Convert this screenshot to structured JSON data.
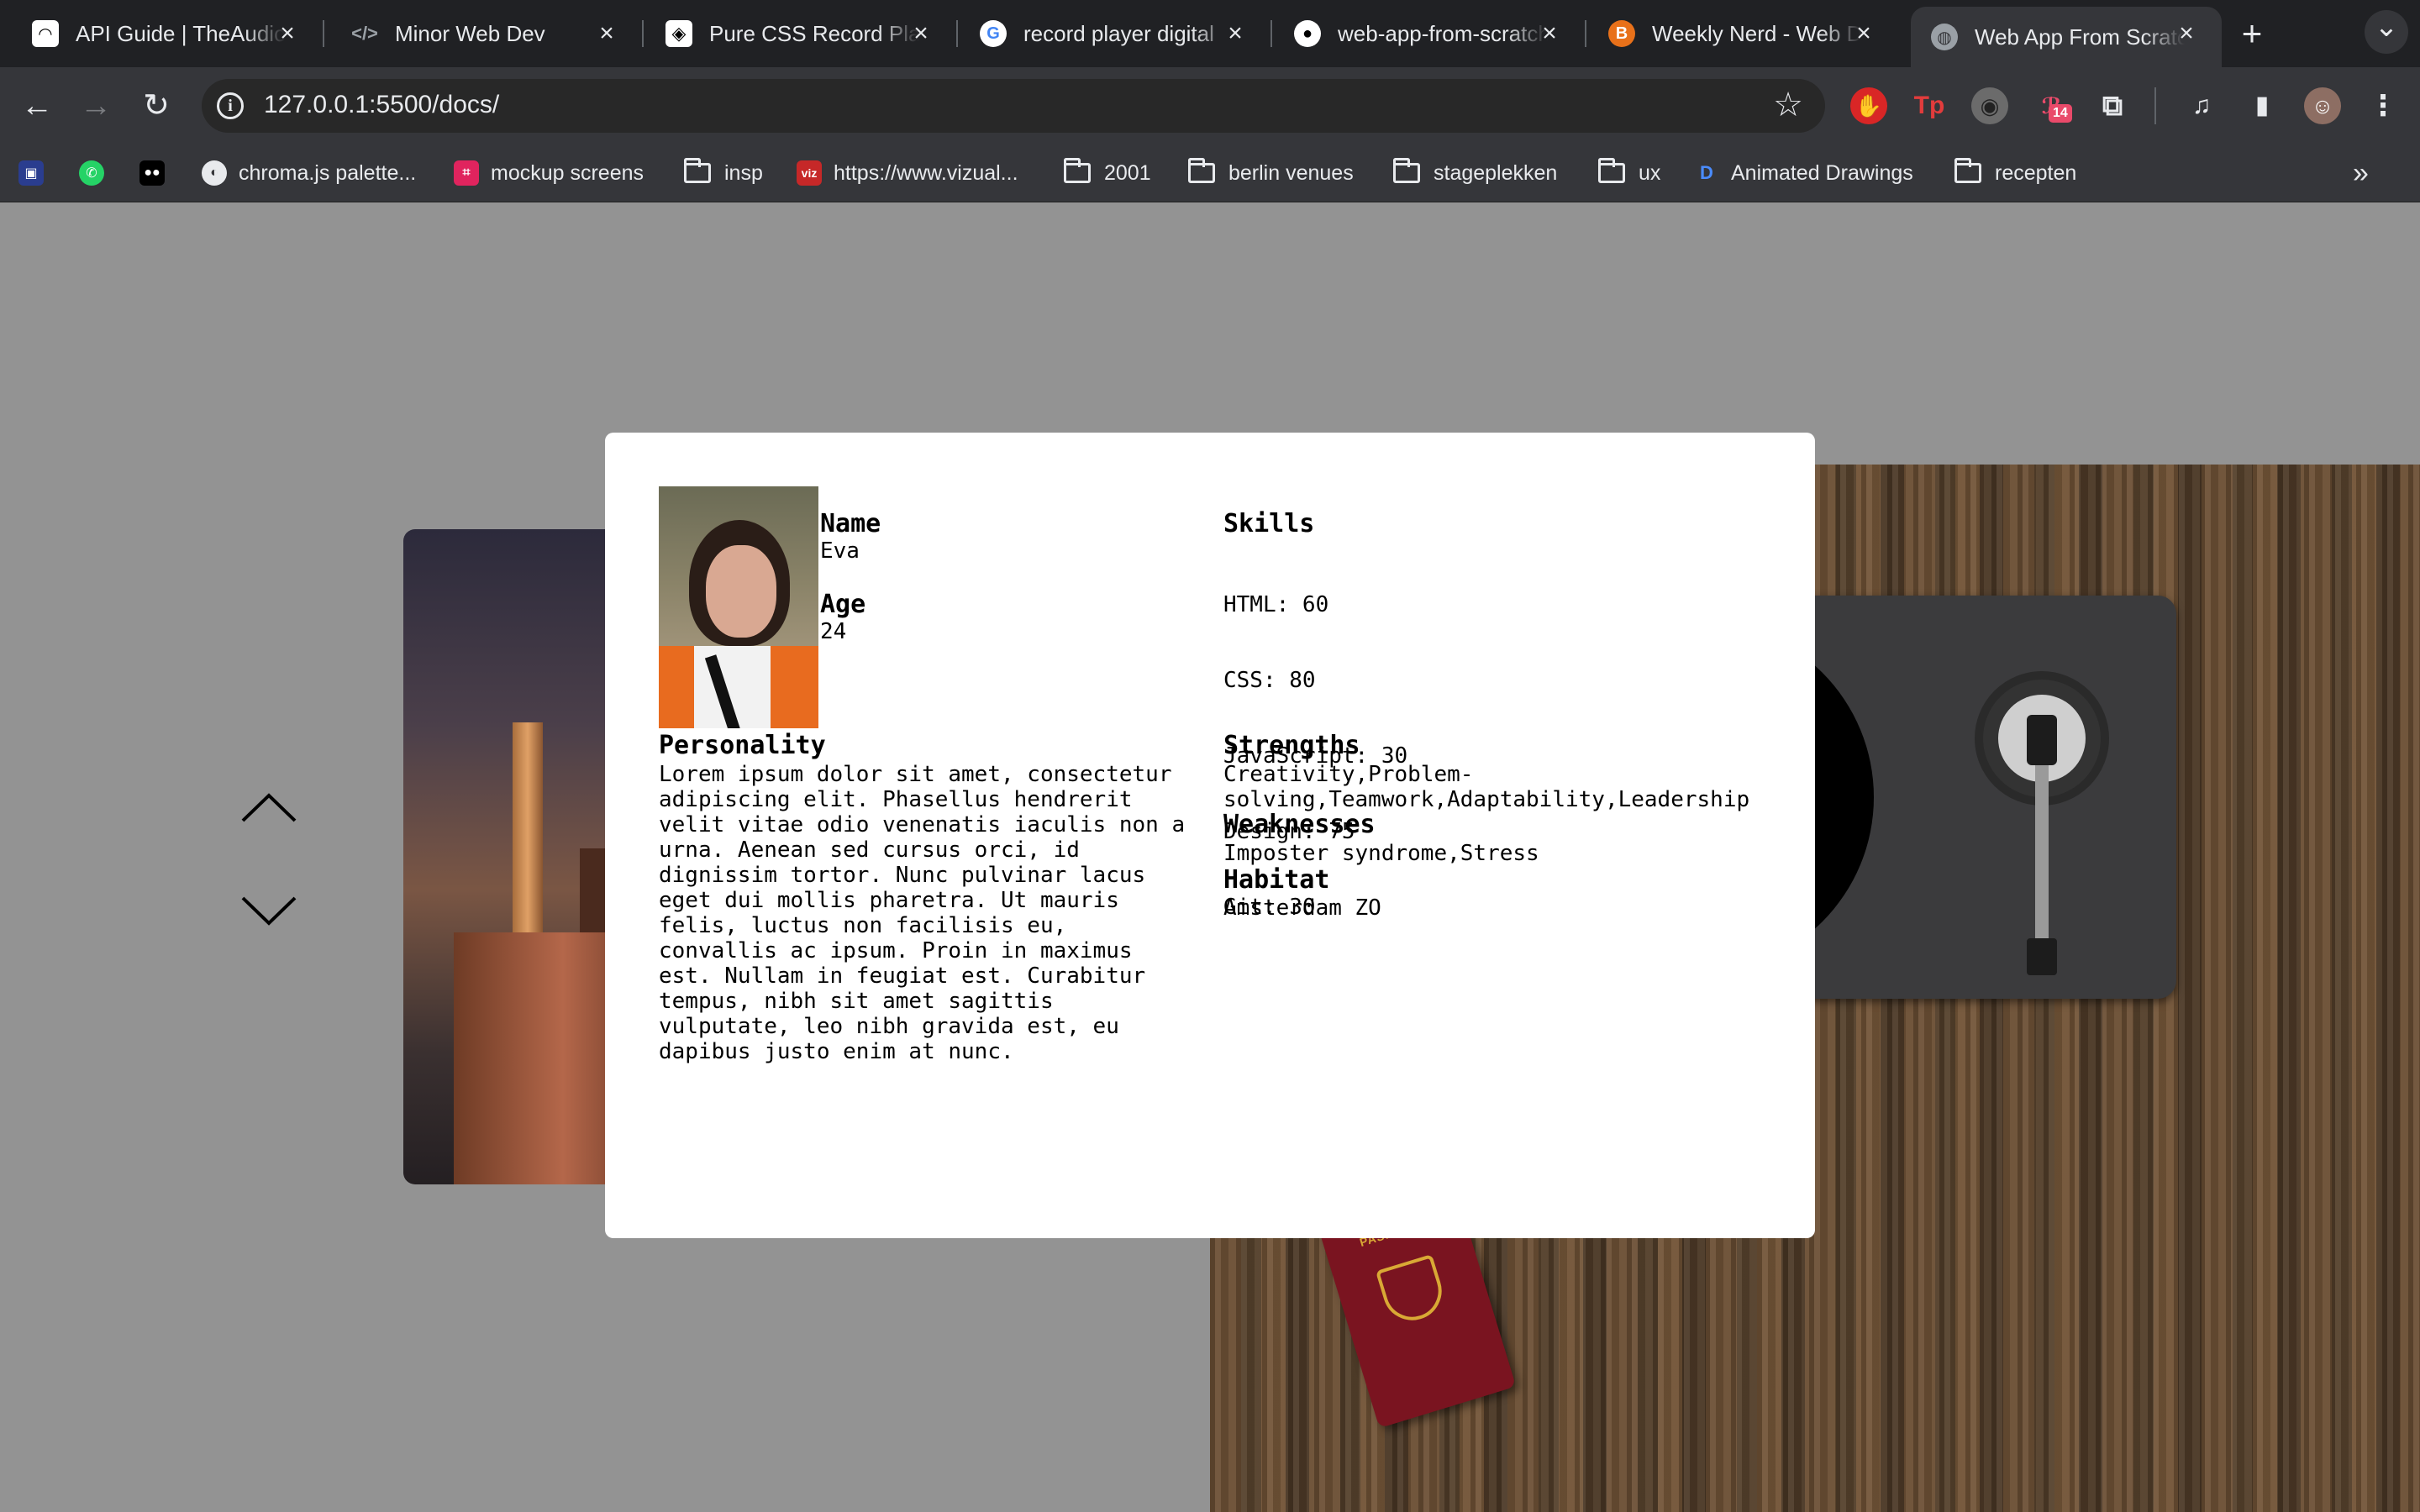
{
  "browser": {
    "tabs": [
      {
        "title": "API Guide | TheAudioDB",
        "favicon": "headphones-icon",
        "active": false
      },
      {
        "title": "Minor Web Dev",
        "favicon": "code-icon",
        "active": false
      },
      {
        "title": "Pure CSS Record Player",
        "favicon": "codepen-icon",
        "active": false
      },
      {
        "title": "record player digital",
        "favicon": "google-icon",
        "active": false
      },
      {
        "title": "web-app-from-scratch",
        "favicon": "github-icon",
        "active": false
      },
      {
        "title": "Weekly Nerd - Web Dev",
        "favicon": "blog-icon",
        "active": false
      },
      {
        "title": "Web App From Scratch",
        "favicon": "globe-icon",
        "active": true
      }
    ],
    "new_tab_symbol": "+",
    "tab_search_symbol": "⌄",
    "address": "127.0.0.1:5500/docs/",
    "extension_badge": "14",
    "bookmarks": [
      {
        "label": "",
        "kind": "icon",
        "icon": "tv-icon"
      },
      {
        "label": "",
        "kind": "icon",
        "icon": "whatsapp-icon"
      },
      {
        "label": "",
        "kind": "icon",
        "icon": "medium-icon"
      },
      {
        "label": "chroma.js palette...",
        "kind": "link",
        "icon": "chroma-icon"
      },
      {
        "label": "mockup screens",
        "kind": "link",
        "icon": "mockup-icon"
      },
      {
        "label": "insp",
        "kind": "folder",
        "icon": "folder-icon"
      },
      {
        "label": "https://www.vizual...",
        "kind": "link",
        "icon": "viz-icon"
      },
      {
        "label": "2001",
        "kind": "folder",
        "icon": "folder-icon"
      },
      {
        "label": "berlin venues",
        "kind": "folder",
        "icon": "folder-icon"
      },
      {
        "label": "stageplekken",
        "kind": "folder",
        "icon": "folder-icon"
      },
      {
        "label": "ux",
        "kind": "folder",
        "icon": "folder-icon"
      },
      {
        "label": "Animated Drawings",
        "kind": "link",
        "icon": "animated-drawings-icon"
      },
      {
        "label": "recepten",
        "kind": "folder",
        "icon": "folder-icon"
      }
    ],
    "bookmark_overflow": "»"
  },
  "page": {
    "nav": {
      "up": "chevron-up-icon",
      "down": "chevron-down-icon"
    },
    "passport_word": "PASPOORT",
    "profile": {
      "name_label": "Name",
      "name": "Eva",
      "age_label": "Age",
      "age": "24",
      "personality_label": "Personality",
      "personality": "Lorem ipsum dolor sit amet, consectetur\nadipiscing elit. Phasellus hendrerit\nvelit vitae odio venenatis iaculis non a\nurna. Aenean sed cursus orci, id\ndignissim tortor. Nunc pulvinar lacus\neget dui mollis pharetra. Ut mauris\nfelis, luctus non facilisis eu,\nconvallis ac ipsum. Proin in maximus\nest. Nullam in feugiat est. Curabitur\ntempus, nibh sit amet sagittis\nvulputate, leo nibh gravida est, eu\ndapibus justo enim at nunc.",
      "skills_label": "Skills",
      "skills": [
        "HTML: 60",
        "CSS: 80",
        "JavaScript: 30",
        "Design: 75",
        "Git: 30"
      ],
      "strengths_label": "Strengths",
      "strengths": "Creativity,Problem-\nsolving,Teamwork,Adaptability,Leadership",
      "weaknesses_label": "Weaknesses",
      "weaknesses": "Imposter syndrome,Stress",
      "habitat_label": "Habitat",
      "habitat": "Amsterdam ZO"
    }
  },
  "colors": {
    "chrome_bg": "#202124",
    "toolbar_bg": "#35363a",
    "page_bg": "#939393",
    "card_bg": "#ffffff",
    "passport": "#7a1420"
  }
}
